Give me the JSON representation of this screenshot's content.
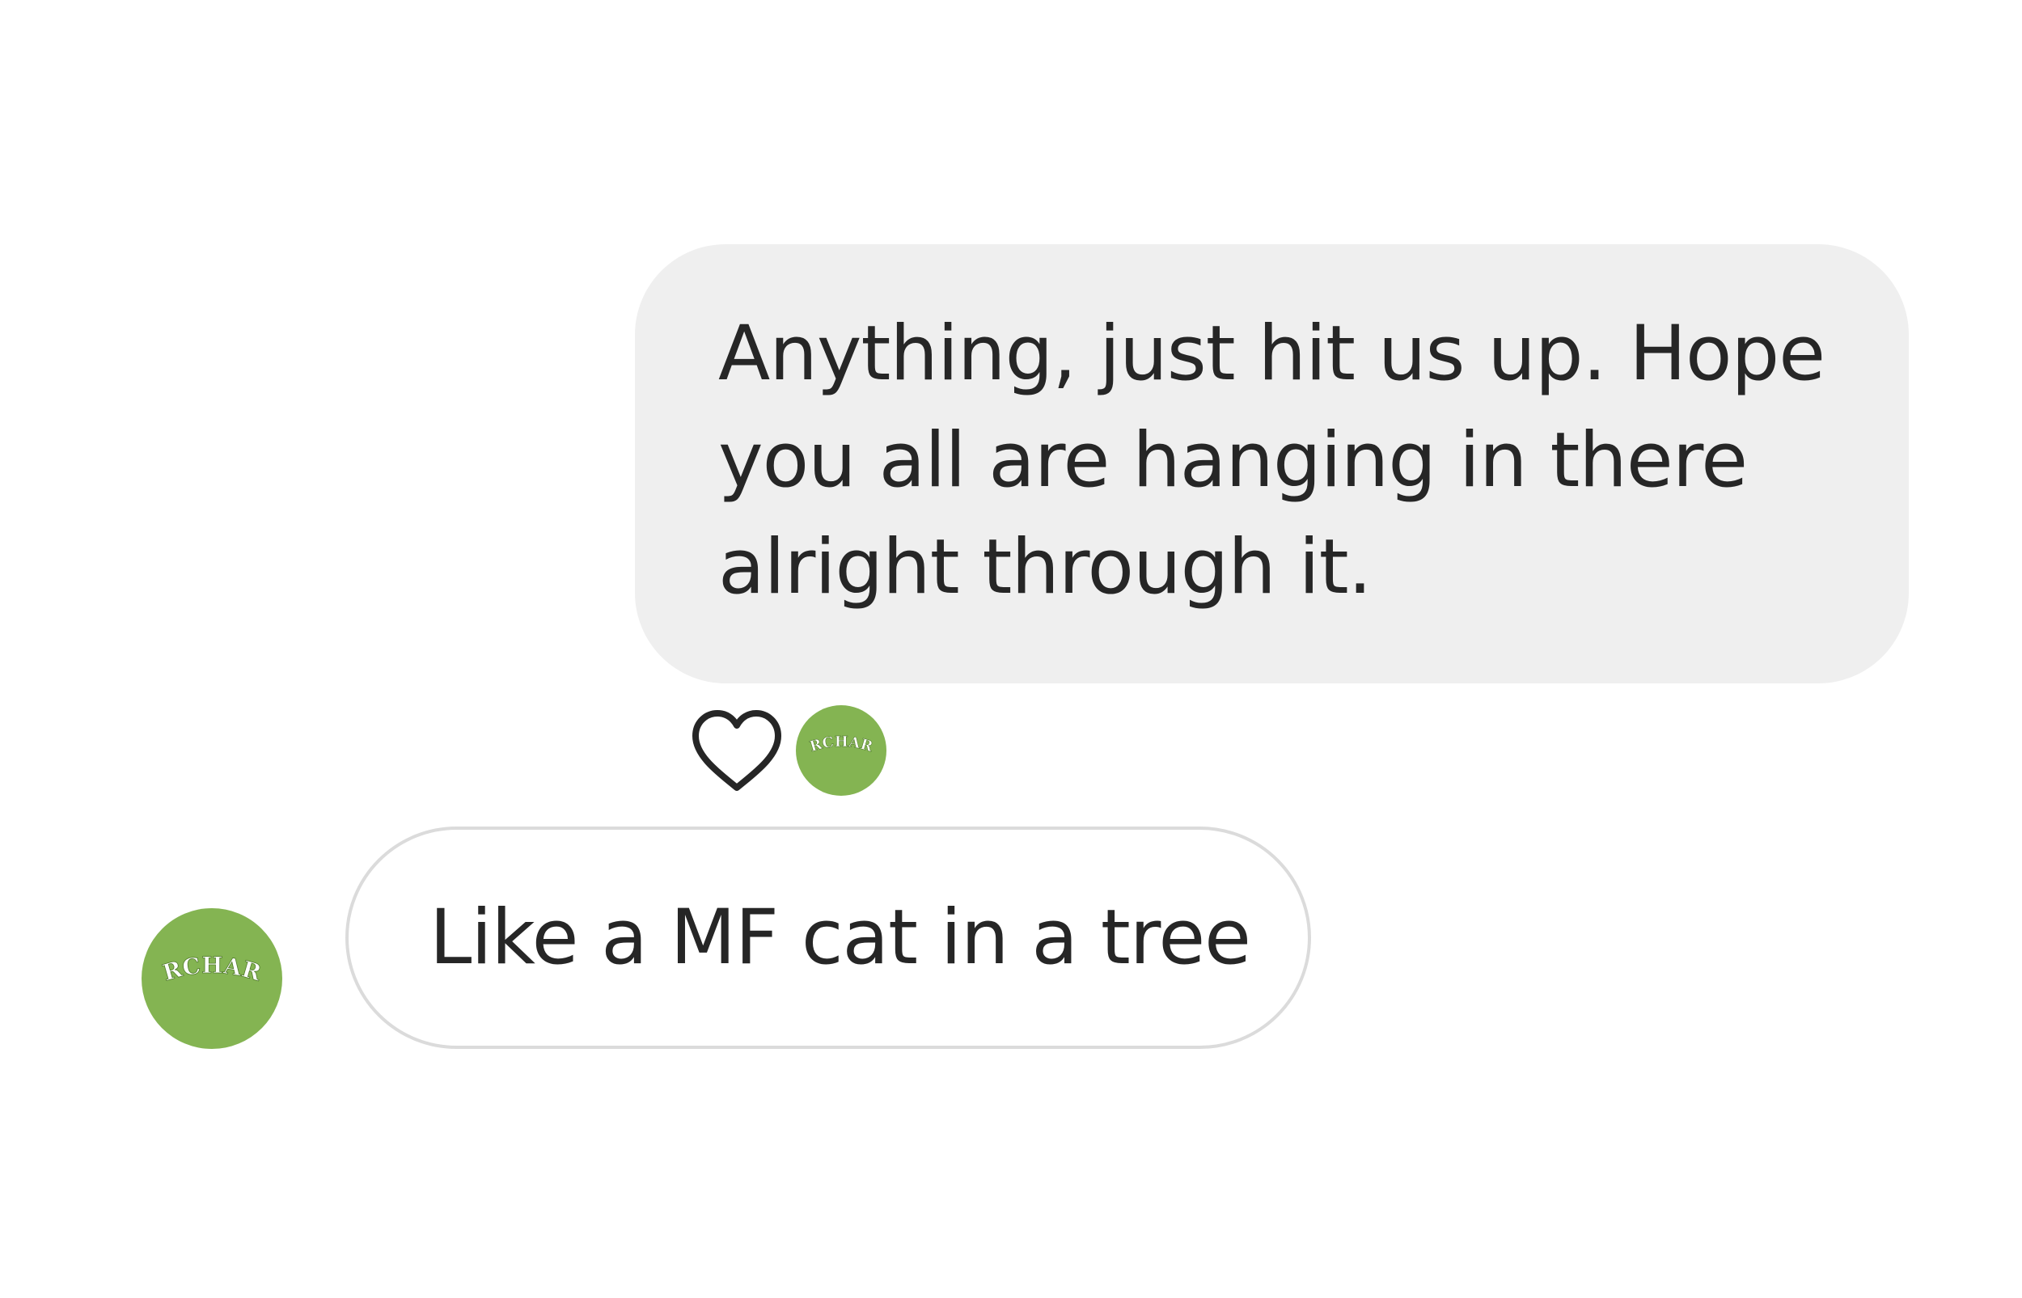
{
  "conversation": {
    "outgoing_message": {
      "text": "Anything, just hit us up. Hope you all are hanging in there alright through it.",
      "bubble_color": "#efefef"
    },
    "reaction": {
      "icon": "heart-icon",
      "reactor_logo_text": "ORCHARD"
    },
    "incoming_message": {
      "text": "Like a MF cat in a tree",
      "border_color": "#dbdbdb"
    },
    "sender_avatar": {
      "logo_text": "ORCHARD",
      "color": "#84b452"
    }
  }
}
